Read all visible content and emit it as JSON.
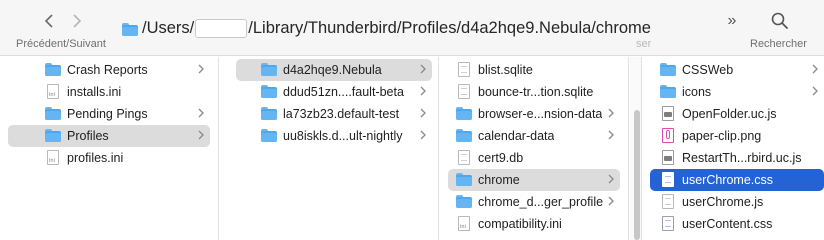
{
  "toolbar": {
    "nav_caption": "Précédent/Suivant",
    "path_prefix": "/Users/",
    "path_suffix": "/Library/Thunderbird/Profiles/d4a2hqe9.Nebula/chrome",
    "hidden_caption": "ser",
    "more_label": "»",
    "search_caption": "Rechercher"
  },
  "columns": [
    {
      "items": [
        {
          "label": "Crash Reports",
          "icon": "folder-icon",
          "chevron": true
        },
        {
          "label": "installs.ini",
          "icon": "ini-file-icon",
          "chevron": false
        },
        {
          "label": "Pending Pings",
          "icon": "folder-icon",
          "chevron": true
        },
        {
          "label": "Profiles",
          "icon": "folder-icon",
          "chevron": true,
          "selected": "gray"
        },
        {
          "label": "profiles.ini",
          "icon": "ini-file-icon",
          "chevron": false
        }
      ]
    },
    {
      "items": [
        {
          "label": "d4a2hqe9.Nebula",
          "icon": "folder-icon",
          "chevron": true,
          "selected": "gray"
        },
        {
          "label": "ddud51zn....fault-beta",
          "icon": "folder-icon",
          "chevron": true
        },
        {
          "label": "la73zb23.default-test",
          "icon": "folder-icon",
          "chevron": true
        },
        {
          "label": "uu8iskls.d...ult-nightly",
          "icon": "folder-icon",
          "chevron": true
        }
      ]
    },
    {
      "items": [
        {
          "label": "blist.sqlite",
          "icon": "file-icon",
          "chevron": false
        },
        {
          "label": "bounce-tr...tion.sqlite",
          "icon": "file-icon",
          "chevron": false
        },
        {
          "label": "browser-e...nsion-data",
          "icon": "folder-icon",
          "chevron": true
        },
        {
          "label": "calendar-data",
          "icon": "folder-icon",
          "chevron": true
        },
        {
          "label": "cert9.db",
          "icon": "file-icon",
          "chevron": false
        },
        {
          "label": "chrome",
          "icon": "folder-icon",
          "chevron": true,
          "selected": "gray"
        },
        {
          "label": "chrome_d...ger_profile",
          "icon": "folder-icon",
          "chevron": true
        },
        {
          "label": "compatibility.ini",
          "icon": "ini-file-icon",
          "chevron": false
        }
      ]
    },
    {
      "items": [
        {
          "label": "CSSWeb",
          "icon": "folder-icon",
          "chevron": true
        },
        {
          "label": "icons",
          "icon": "folder-icon",
          "chevron": true
        },
        {
          "label": "OpenFolder.uc.js",
          "icon": "js-file-icon",
          "chevron": false
        },
        {
          "label": "paper-clip.png",
          "icon": "png-file-icon",
          "chevron": false
        },
        {
          "label": "RestartTh...rbird.uc.js",
          "icon": "js-file-icon",
          "chevron": false
        },
        {
          "label": "userChrome.css",
          "icon": "css-file-icon",
          "chevron": false,
          "selected": "blue"
        },
        {
          "label": "userChrome.js",
          "icon": "file-icon",
          "chevron": false
        },
        {
          "label": "userContent.css",
          "icon": "css-file-icon",
          "chevron": false
        }
      ]
    }
  ],
  "colors": {
    "selection_blue": "#2463d6",
    "selection_gray": "#dcdcdc",
    "folder_blue": "#4ea6ec"
  }
}
